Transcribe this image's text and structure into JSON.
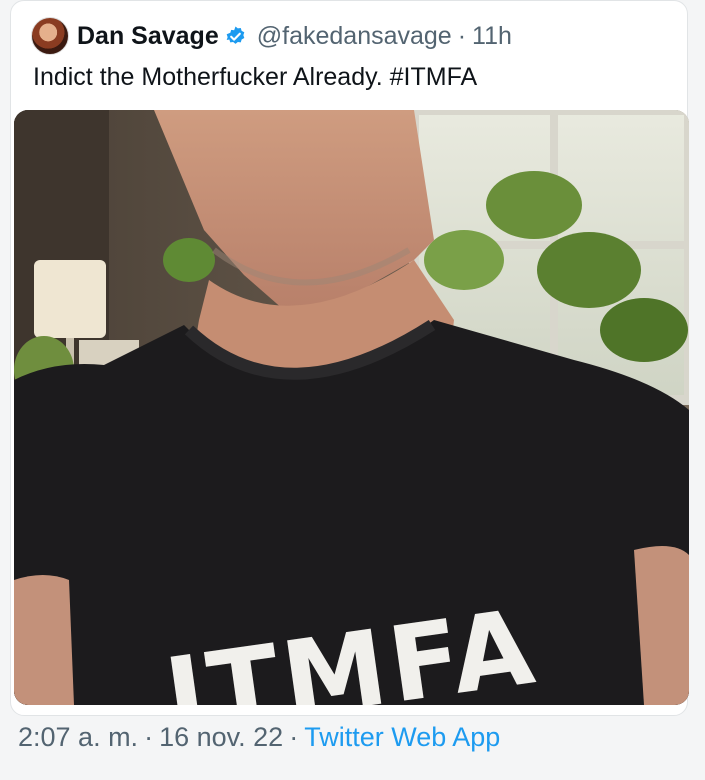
{
  "tweet": {
    "author_name": "Dan Savage",
    "handle": "@fakedansavage",
    "separator": "·",
    "relative_time": "11h",
    "text": "Indict the Motherfucker Already. #ITMFA",
    "photo_shirt_text": "ITMFA",
    "verified_color": "#1d9bf0"
  },
  "footer": {
    "time": "2:07 a. m.",
    "separator": "·",
    "date": "16 nov. 22",
    "source": "Twitter Web App",
    "source_color": "#1d9bf0"
  }
}
